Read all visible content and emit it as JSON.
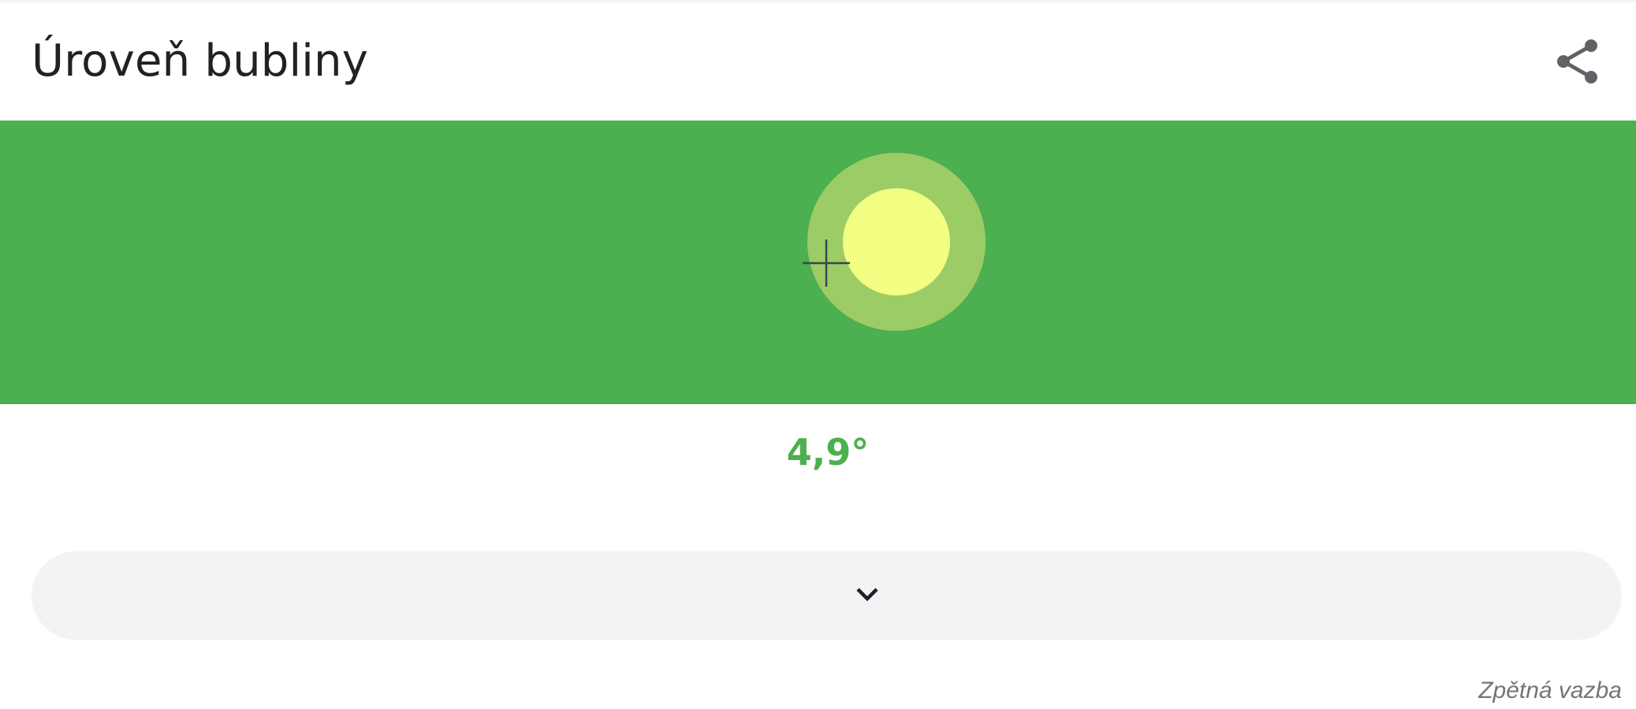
{
  "header": {
    "title": "Úroveň bubliny",
    "share_icon": "share-icon"
  },
  "level": {
    "background_color": "#4caf50",
    "outer_ring_color": "#9ccc65",
    "bubble_color": "#f2ff82",
    "crosshair_icon": "crosshair-icon",
    "angle_text": "4,9°"
  },
  "expand": {
    "icon": "chevron-down-icon"
  },
  "footer": {
    "feedback_label": "Zpětná vazba"
  }
}
